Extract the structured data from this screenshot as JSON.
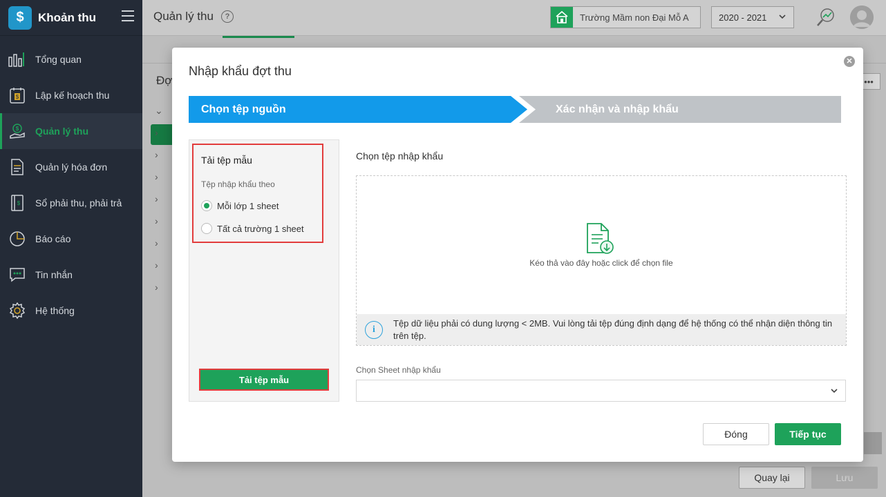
{
  "app": {
    "title": "Khoản thu"
  },
  "sidebar": {
    "items": [
      {
        "label": "Tổng quan",
        "icon": "bar-chart-icon"
      },
      {
        "label": "Lập kế hoạch thu",
        "icon": "calendar-dollar-icon"
      },
      {
        "label": "Quản lý thu",
        "icon": "money-hand-icon",
        "active": true
      },
      {
        "label": "Quản lý hóa đơn",
        "icon": "document-icon"
      },
      {
        "label": "Sổ phải thu, phải trả",
        "icon": "ledger-icon"
      },
      {
        "label": "Báo cáo",
        "icon": "pie-chart-icon"
      },
      {
        "label": "Tin nhắn",
        "icon": "chat-icon"
      },
      {
        "label": "Hệ thống",
        "icon": "gear-icon"
      }
    ]
  },
  "header": {
    "title": "Quản lý thu",
    "school": "Trường Mầm non Đại Mỗ A",
    "year": "2020 - 2021"
  },
  "background": {
    "heading": "Đợ",
    "back_label": "Quay lại",
    "save_label": "Lưu"
  },
  "modal": {
    "title": "Nhập khẩu đợt thu",
    "steps": [
      "Chọn tệp nguồn",
      "Xác nhận và nhập khẩu"
    ],
    "template": {
      "title": "Tải tệp mẫu",
      "subtitle": "Tệp nhập khẩu theo",
      "options": [
        "Mỗi lớp 1 sheet",
        "Tất cả trường 1 sheet"
      ],
      "selected_index": 0,
      "download_label": "Tải tệp mẫu"
    },
    "import": {
      "label": "Chọn tệp nhập khẩu",
      "drop_text": "Kéo thả vào đây hoặc click để chọn file",
      "info": "Tệp dữ liệu phải có dung lượng < 2MB. Vui lòng tải tệp đúng định dạng để hệ thống có thể nhận diện thông tin trên tệp."
    },
    "sheet": {
      "label": "Chọn Sheet nhập khẩu",
      "value": ""
    },
    "buttons": {
      "close": "Đóng",
      "continue": "Tiếp tục"
    }
  },
  "colors": {
    "accent": "#1ea25a",
    "step_active": "#129aea",
    "step_inactive": "#bfc3c7",
    "highlight": "#e23c3c"
  }
}
